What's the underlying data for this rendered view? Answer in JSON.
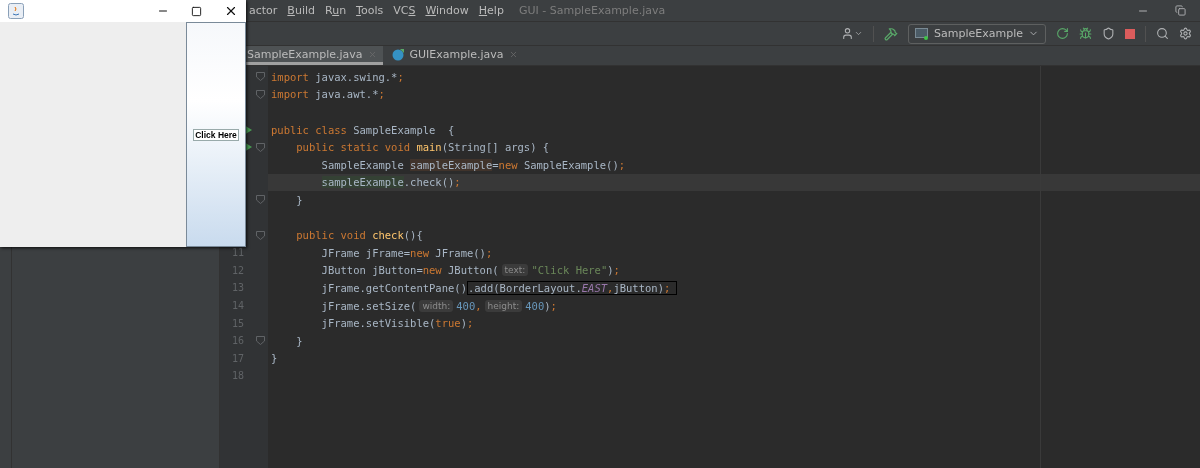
{
  "swing_window": {
    "button": {
      "label": "Click Here"
    }
  },
  "menu": [
    {
      "rest": "actor"
    },
    {
      "key": "B",
      "rest": "uild"
    },
    {
      "lead": "R",
      "key": "u",
      "rest": "n"
    },
    {
      "key": "T",
      "rest": "ools"
    },
    {
      "lead": "VC",
      "key": "S"
    },
    {
      "key": "W",
      "rest": "indow"
    },
    {
      "key": "H",
      "rest": "elp"
    }
  ],
  "window_title": "GUI - SampleExample.java",
  "run_config": {
    "label": "SampleExample"
  },
  "tabs": [
    {
      "label": "SampleExample.java",
      "selected": true,
      "icon": false
    },
    {
      "label": "GUIExample.java",
      "selected": false,
      "icon": true
    }
  ],
  "editor": {
    "lines": [
      {
        "run": false,
        "fold": true,
        "current": false,
        "tokens": [
          {
            "text": "import",
            "kind": "keyword"
          },
          {
            "text": " javax.swing.*",
            "kind": "plain"
          },
          {
            "text": ";",
            "kind": "keyword"
          }
        ]
      },
      {
        "run": false,
        "fold": true,
        "current": false,
        "tokens": [
          {
            "text": "import",
            "kind": "keyword"
          },
          {
            "text": " java.awt.*",
            "kind": "plain"
          },
          {
            "text": ";",
            "kind": "keyword"
          }
        ]
      },
      {
        "run": false,
        "fold": false,
        "current": false
      },
      {
        "run": true,
        "fold": false,
        "current": false,
        "tokens": [
          {
            "text": "public class",
            "kind": "keyword"
          },
          {
            "text": " SampleExample  {",
            "kind": "plain"
          }
        ],
        "children": [
          {
            "run": true,
            "fold": true,
            "current": false,
            "tokens": [
              {
                "text": "public static void",
                "kind": "keyword"
              },
              {
                "text": " main",
                "kind": "method"
              },
              {
                "text": "(String[] args) {",
                "kind": "plain"
              }
            ],
            "children": [
              {
                "run": false,
                "fold": false,
                "current": false,
                "tokens": [
                  {
                    "text": "SampleExample ",
                    "kind": "plain"
                  },
                  {
                    "text": "sampleExample",
                    "kind": "declaration"
                  },
                  {
                    "text": "=",
                    "kind": "plain"
                  },
                  {
                    "text": "new",
                    "kind": "keyword"
                  },
                  {
                    "text": " SampleExample()",
                    "kind": "plain"
                  },
                  {
                    "text": ";",
                    "kind": "keyword"
                  }
                ]
              },
              {
                "run": false,
                "fold": false,
                "current": true,
                "tokens": [
                  {
                    "text": "sampleExample",
                    "kind": "usage"
                  },
                  {
                    "text": ".check()",
                    "kind": "plain"
                  },
                  {
                    "text": ";",
                    "kind": "keyword"
                  }
                ]
              }
            ]
          },
          {
            "run": false,
            "fold": true,
            "current": false,
            "tokens": [
              {
                "text": "}",
                "kind": "plain"
              }
            ]
          },
          {
            "run": false,
            "fold": false,
            "current": false
          },
          {
            "run": false,
            "fold": true,
            "current": false,
            "tokens": [
              {
                "text": "public void",
                "kind": "keyword"
              },
              {
                "text": " check",
                "kind": "method"
              },
              {
                "text": "(){",
                "kind": "plain"
              }
            ],
            "children": [
              {
                "number": "11",
                "run": false,
                "fold": false,
                "current": false,
                "tokens": [
                  {
                    "text": "JFrame jFrame=",
                    "kind": "plain"
                  },
                  {
                    "text": "new",
                    "kind": "keyword"
                  },
                  {
                    "text": " JFrame()",
                    "kind": "plain"
                  },
                  {
                    "text": ";",
                    "kind": "keyword"
                  }
                ]
              },
              {
                "number": "12",
                "run": false,
                "fold": false,
                "current": false,
                "tokens": [
                  {
                    "text": "JButton jButton=",
                    "kind": "plain"
                  },
                  {
                    "text": "new",
                    "kind": "keyword"
                  },
                  {
                    "text": " JButton(",
                    "kind": "plain"
                  },
                  {
                    "text": "text:",
                    "kind": "hint"
                  },
                  {
                    "text": "\"Click Here\"",
                    "kind": "string"
                  },
                  {
                    "text": ")",
                    "kind": "plain"
                  },
                  {
                    "text": ";",
                    "kind": "keyword"
                  }
                ]
              },
              {
                "number": "13",
                "run": false,
                "fold": false,
                "current": false,
                "tokens": [
                  {
                    "text": "jFrame.getContentPane()",
                    "kind": "plain"
                  }
                ],
                "frame": {
                  "tokens": [
                    {
                      "text": ".add(BorderLayout.",
                      "kind": "plain"
                    },
                    {
                      "text": "EAST",
                      "kind": "constant"
                    },
                    {
                      "text": ",",
                      "kind": "keyword"
                    },
                    {
                      "text": "jButton)",
                      "kind": "plain"
                    },
                    {
                      "text": ";",
                      "kind": "keyword"
                    }
                  ]
                }
              },
              {
                "number": "14",
                "run": false,
                "fold": false,
                "current": false,
                "tokens": [
                  {
                    "text": "jFrame.setSize(",
                    "kind": "plain"
                  },
                  {
                    "text": "width:",
                    "kind": "hint"
                  },
                  {
                    "text": "400",
                    "kind": "number"
                  },
                  {
                    "text": ",",
                    "kind": "keyword"
                  },
                  {
                    "text": "height:",
                    "kind": "hint"
                  },
                  {
                    "text": "400",
                    "kind": "number"
                  },
                  {
                    "text": ")",
                    "kind": "plain"
                  },
                  {
                    "text": ";",
                    "kind": "keyword"
                  }
                ]
              },
              {
                "number": "15",
                "run": false,
                "fold": false,
                "current": false,
                "tokens": [
                  {
                    "text": "jFrame.setVisible(",
                    "kind": "plain"
                  },
                  {
                    "text": "true",
                    "kind": "keyword"
                  },
                  {
                    "text": ")",
                    "kind": "plain"
                  },
                  {
                    "text": ";",
                    "kind": "keyword"
                  }
                ]
              }
            ]
          },
          {
            "number": "16",
            "run": false,
            "fold": true,
            "current": false,
            "tokens": [
              {
                "text": "}",
                "kind": "plain"
              }
            ]
          }
        ]
      },
      {
        "number": "17",
        "run": false,
        "fold": false,
        "current": false,
        "tokens": [
          {
            "text": "}",
            "kind": "plain"
          }
        ]
      },
      {
        "number": "18",
        "run": false,
        "fold": false,
        "current": false
      }
    ]
  }
}
